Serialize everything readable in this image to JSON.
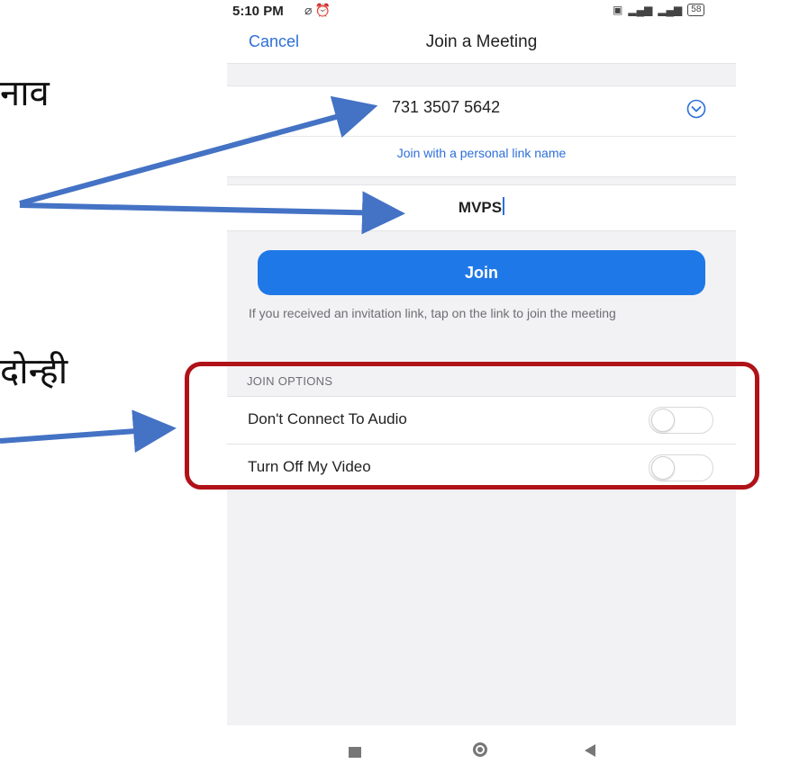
{
  "annotations": {
    "top_text": "नाव",
    "middle_text": "दोन्ही"
  },
  "status_bar": {
    "time": "5:10 PM",
    "battery": "58"
  },
  "nav": {
    "cancel_label": "Cancel",
    "title": "Join a Meeting"
  },
  "meeting": {
    "id": "731 3507 5642",
    "personal_link_label": "Join with a personal link name",
    "display_name": "MVPS"
  },
  "join_button_label": "Join",
  "hint_text": "If you received an invitation link, tap on the link to join the meeting",
  "join_options": {
    "header": "JOIN OPTIONS",
    "items": [
      {
        "label": "Don't Connect To Audio",
        "enabled": false
      },
      {
        "label": "Turn Off My Video",
        "enabled": false
      }
    ]
  },
  "colors": {
    "accent": "#1f78e8",
    "link": "#2d6fd8",
    "highlight_border": "#b01217",
    "arrow": "#4472c4"
  }
}
